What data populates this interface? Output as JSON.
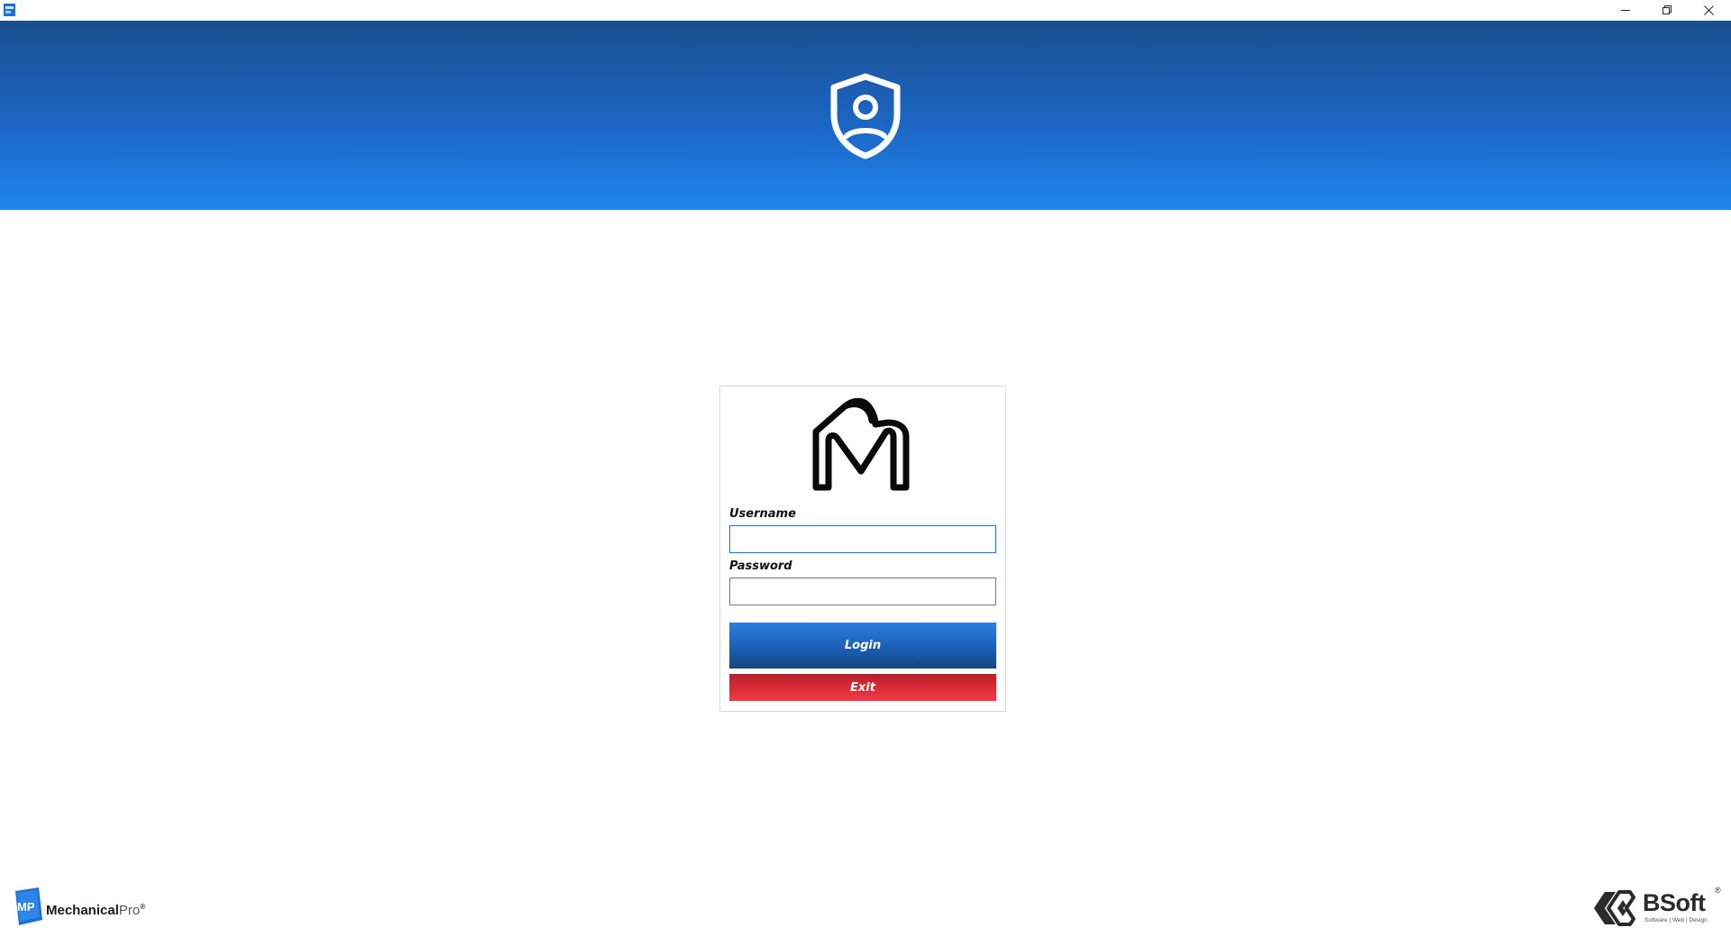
{
  "window": {
    "app_icon": "mechanicalpro-app-icon",
    "controls": {
      "minimize_icon": "minimize-icon",
      "restore_icon": "restore-icon",
      "close_icon": "close-icon"
    }
  },
  "banner": {
    "icon": "shield-user-icon",
    "colors": {
      "top": "#1a4f8f",
      "bottom": "#1f86ee"
    }
  },
  "login": {
    "logo": "mechanicalpro-m-heart-logo",
    "username_label": "Username",
    "username_value": "",
    "password_label": "Password",
    "password_value": "",
    "login_button": "Login",
    "exit_button": "Exit",
    "colors": {
      "login": "#1b5fb5",
      "exit": "#d92a36"
    }
  },
  "footer": {
    "left_brand": {
      "badge": "MP",
      "name_bold": "Mechanical",
      "name_light": "Pro",
      "reg": "®"
    },
    "right_brand": {
      "name": "BSoft",
      "tagline": "Software | Web | Design",
      "reg": "®"
    }
  }
}
